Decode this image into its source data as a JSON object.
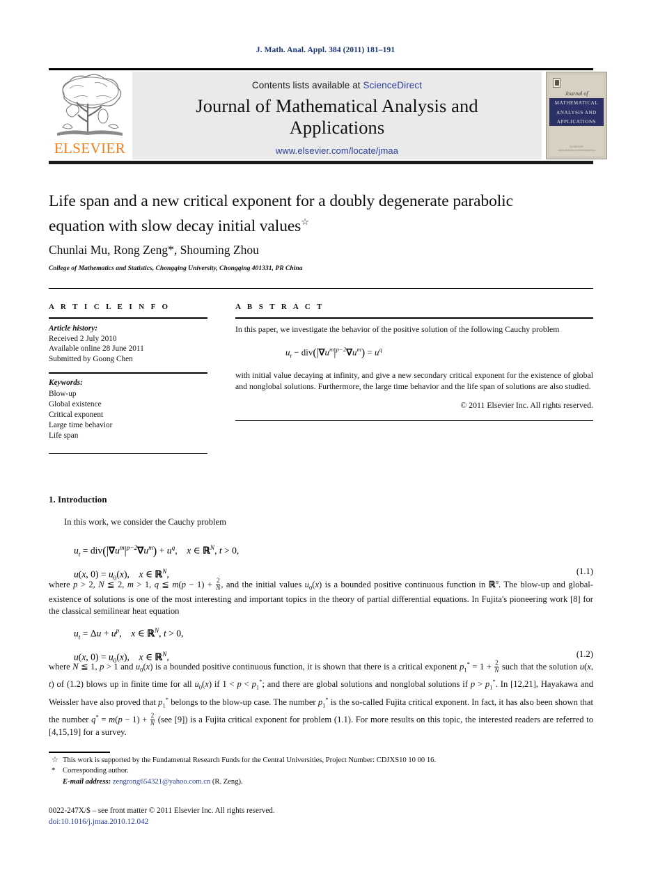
{
  "running_head": "J. Math. Anal. Appl. 384 (2011) 181–191",
  "masthead": {
    "publisher": "ELSEVIER",
    "contents_prefix": "Contents lists available at ",
    "contents_link": "ScienceDirect",
    "journal_title_line1": "Journal of Mathematical Analysis and",
    "journal_title_line2": "Applications",
    "journal_url": "www.elsevier.com/locate/jmaa",
    "cover": {
      "script": "Journal of",
      "band_line1": "MATHEMATICAL",
      "band_line2": "ANALYSIS AND",
      "band_line3": "APPLICATIONS",
      "foot_line1": "ELSEVIER",
      "foot_line2": "www.elsevier.com/locate/jmaa"
    }
  },
  "article": {
    "title_line1": "Life span and a new critical exponent for a doubly degenerate parabolic",
    "title_line2": "equation with slow decay initial values",
    "title_footnote_mark": "☆",
    "authors": "Chunlai Mu, Rong Zeng*, Shouming Zhou",
    "affiliation": "College of Mathematics and Statistics, Chongqing University, Chongqing 401331, PR China"
  },
  "info": {
    "heading": "A R T I C L E    I N F O",
    "history_label": "Article history:",
    "history": [
      "Received 2 July 2010",
      "Available online 28 June 2011",
      "Submitted by Goong Chen"
    ],
    "keywords_label": "Keywords:",
    "keywords": [
      "Blow-up",
      "Global existence",
      "Critical exponent",
      "Large time behavior",
      "Life span"
    ]
  },
  "abstract": {
    "heading": "A B S T R A C T",
    "para1": "In this paper, we investigate the behavior of the positive solution of the following Cauchy problem",
    "para2": "with initial value decaying at infinity, and give a new secondary critical exponent for the existence of global and nonglobal solutions. Furthermore, the large time behavior and the life span of solutions are also studied.",
    "copyright": "© 2011 Elsevier Inc. All rights reserved."
  },
  "intro": {
    "heading": "1. Introduction",
    "lead": "In this work, we consider the Cauchy problem",
    "eq11_number": "(1.1)",
    "eq12_number": "(1.2)",
    "para_after_11_a": "where ",
    "para_after_11_b": ", and the initial values ",
    "para_after_11_c": " is a bounded positive continuous function in ",
    "para_after_11_d": ". The blow-up and global-existence of solutions is one of the most interesting and important topics in the theory of partial differential equations. In Fujita's pioneering work [8] for the classical semilinear heat equation",
    "para_after_12_text": "where N ⩾ 1, p > 1 and u0(x) is a bounded positive continuous function, it is shown that there is a critical exponent p1* = 1 + 2/N such that the solution u(x, t) of (1.2) blows up in finite time for all u0(x) if 1 < p < p1*; and there are global solutions and nonglobal solutions if p > p1*. In [12,21], Hayakawa and Weissler have also proved that p1* belongs to the blow-up case. The number p1* is the so-called Fujita critical exponent. In fact, it has also been shown that the number q* = m(p − 1) + 2/N (see [9]) is a Fujita critical exponent for problem (1.1). For more results on this topic, the interested readers are referred to [4,15,19] for a survey."
  },
  "footnotes": {
    "mark_star": "☆",
    "note_funding": "This work is supported by the Fundamental Research Funds for the Central Universities, Project Number: CDJXS10 10 00 16.",
    "mark_asterisk": "*",
    "note_corresponding": "Corresponding author.",
    "email_label": "E-mail address:",
    "email": "zengrong654321@yahoo.com.cn",
    "email_suffix": "(R. Zeng)."
  },
  "imprint": {
    "issn_line": "0022-247X/$ – see front matter  © 2011 Elsevier Inc. All rights reserved.",
    "doi": "doi:10.1016/j.jmaa.2010.12.042"
  }
}
